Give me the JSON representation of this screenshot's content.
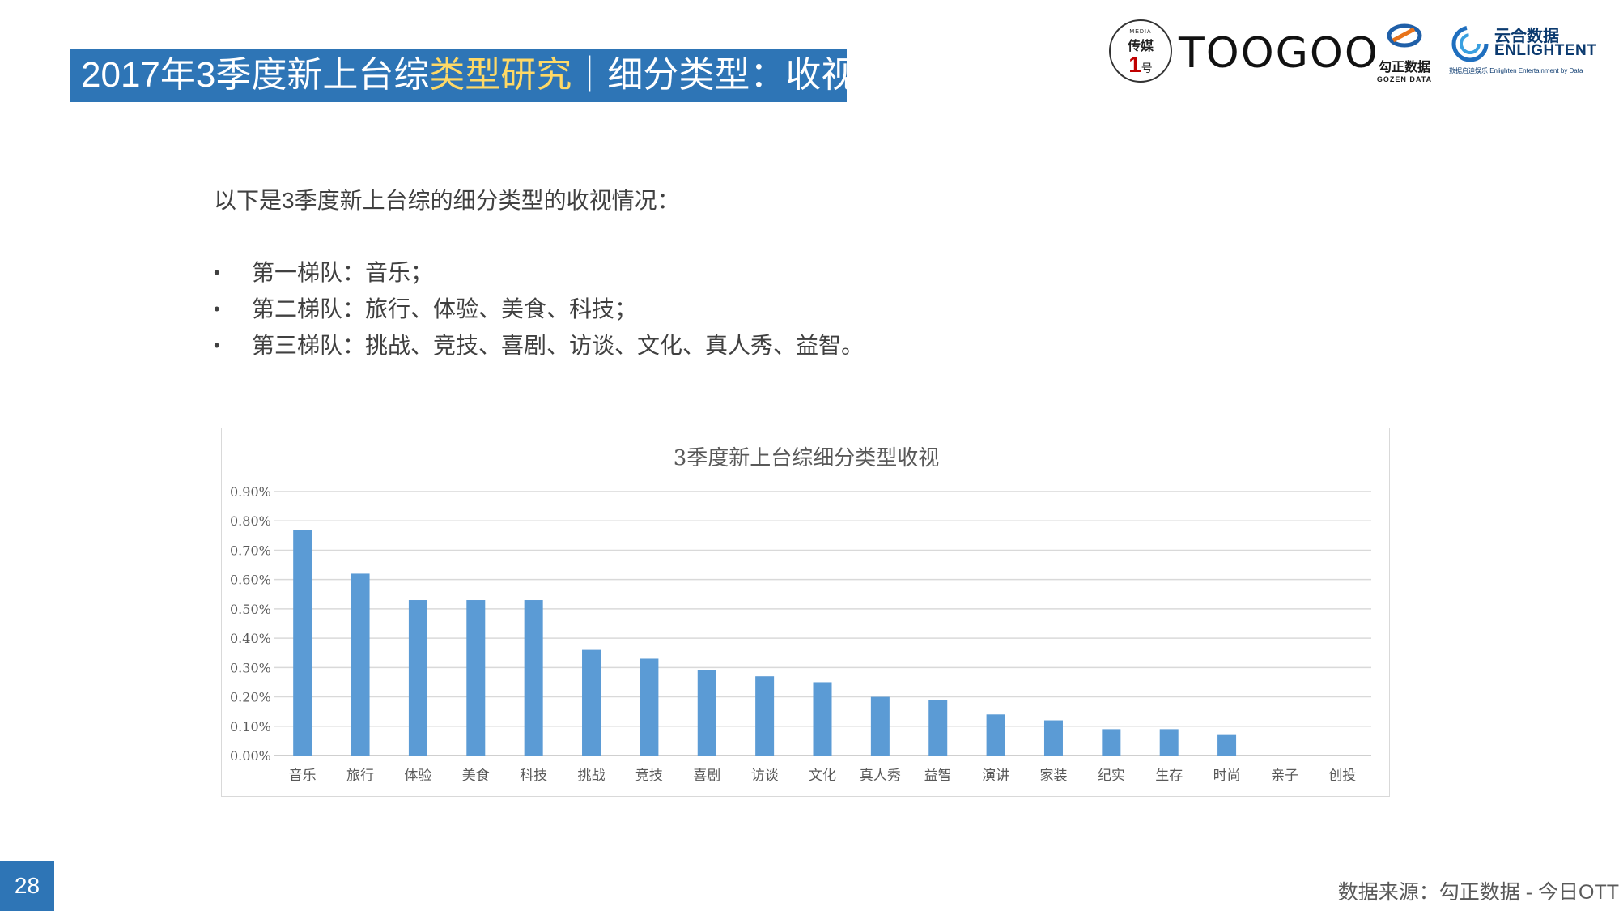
{
  "header": {
    "title_part1": "2017年3季度新上台综",
    "title_highlight": "类型研究",
    "title_part2": "｜细分类型：收视",
    "highlight_color": "#ffd966",
    "bar_color": "#2e75b6"
  },
  "logos": {
    "media_small": "MEDIA",
    "media_cn": "传媒",
    "media_num": "1",
    "media_hao": "号",
    "toogoo": "TOOGOO",
    "gozen_cn": "勾正数据",
    "gozen_en": "GOZEN DATA",
    "enlight_cn": "云合数据",
    "enlight_en": "ENLIGHTENT",
    "enlight_sub": "数据启迪娱乐 Enlighten Entertainment by Data"
  },
  "intro": "以下是3季度新上台综的细分类型的收视情况：",
  "bullets": [
    "第一梯队：音乐；",
    "第二梯队：旅行、体验、美食、科技；",
    "第三梯队：挑战、竞技、喜剧、访谈、文化、真人秀、益智。"
  ],
  "bullet_symbol": "•",
  "chart_data": {
    "type": "bar",
    "title": "3季度新上台综细分类型收视",
    "categories": [
      "音乐",
      "旅行",
      "体验",
      "美食",
      "科技",
      "挑战",
      "竞技",
      "喜剧",
      "访谈",
      "文化",
      "真人秀",
      "益智",
      "演讲",
      "家装",
      "纪实",
      "生存",
      "时尚",
      "亲子",
      "创投"
    ],
    "values": [
      0.77,
      0.62,
      0.53,
      0.53,
      0.53,
      0.36,
      0.33,
      0.29,
      0.27,
      0.25,
      0.2,
      0.19,
      0.14,
      0.12,
      0.09,
      0.09,
      0.07,
      0.0,
      0.0
    ],
    "value_unit": "%",
    "ylim": [
      0,
      0.9
    ],
    "yticks": [
      "0.00%",
      "0.10%",
      "0.20%",
      "0.30%",
      "0.40%",
      "0.50%",
      "0.60%",
      "0.70%",
      "0.80%",
      "0.90%"
    ],
    "grid": true,
    "bar_color": "#5b9bd5",
    "xlabel": "",
    "ylabel": ""
  },
  "footer": {
    "page_number": "28",
    "source": "数据来源：勾正数据 - 今日OTT"
  }
}
